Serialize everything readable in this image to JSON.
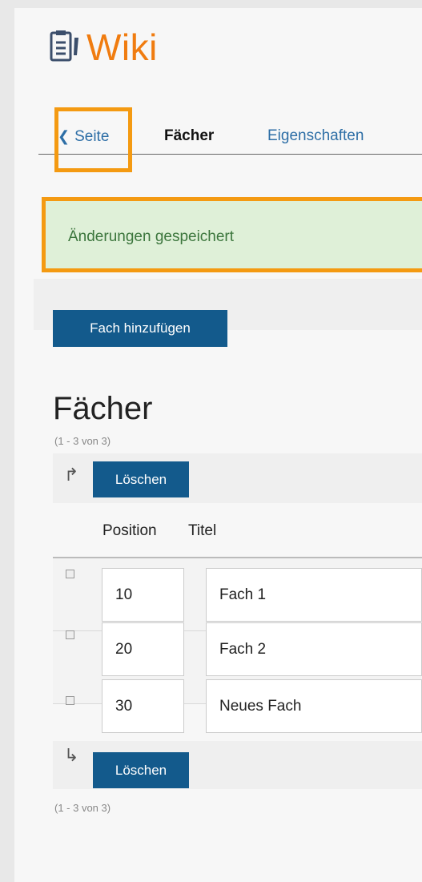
{
  "app": {
    "title": "Wiki",
    "logo_icon": "document-pencil-icon",
    "accent": "#f07c10"
  },
  "tabs": [
    {
      "label": "Seite",
      "icon": "chevron-left-icon",
      "active": false
    },
    {
      "label": "Fächer",
      "active": true
    },
    {
      "label": "Eigenschaften",
      "active": false
    }
  ],
  "alert": {
    "text": "Änderungen gespeichert",
    "status": "success"
  },
  "toolbar": {
    "add_button": "Fach hinzufügen"
  },
  "section": {
    "title": "Fächer",
    "count_top": "(1 - 3 von 3)",
    "count_bottom": "(1 - 3 von 3)"
  },
  "actions": {
    "delete_top": "Löschen",
    "delete_bottom": "Löschen"
  },
  "table": {
    "headers": {
      "position": "Position",
      "title": "Titel"
    },
    "rows": [
      {
        "position": "10",
        "title": "Fach 1",
        "checked": false
      },
      {
        "position": "20",
        "title": "Fach 2",
        "checked": false
      },
      {
        "position": "30",
        "title": "Neues Fach",
        "checked": false
      }
    ]
  },
  "colors": {
    "button": "#135a8c",
    "link": "#2d6ea6",
    "highlight": "#f49a12",
    "alert_bg": "#dff0d8"
  }
}
